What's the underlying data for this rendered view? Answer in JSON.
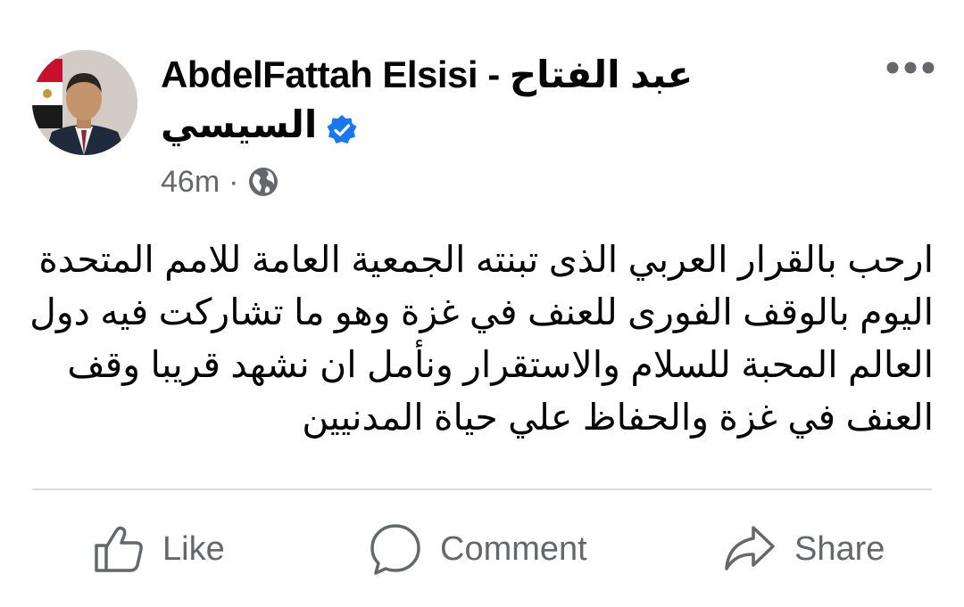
{
  "post": {
    "author_line1": "AbdelFattah Elsisi - عبد الفتاح",
    "author_line2": "السيسي",
    "time": "46m",
    "separator": "·",
    "audience_icon": "globe-icon",
    "verified_icon": "verified-badge-icon",
    "more_icon": "more-options-icon",
    "text": "ارحب بالقرار العربي الذى تبنته الجمعية العامة للامم المتحدة اليوم بالوقف الفورى للعنف في غزة وهو ما تشاركت فيه دول العالم المحبة للسلام والاستقرار ونأمل ان نشهد قريبا وقف العنف في غزة والحفاظ علي حياة المدنيين"
  },
  "actions": {
    "like_label": "Like",
    "comment_label": "Comment",
    "share_label": "Share"
  },
  "colors": {
    "verified_blue": "#1877f2",
    "meta_gray": "#65676b",
    "text": "#050505",
    "divider": "#dadde1"
  }
}
